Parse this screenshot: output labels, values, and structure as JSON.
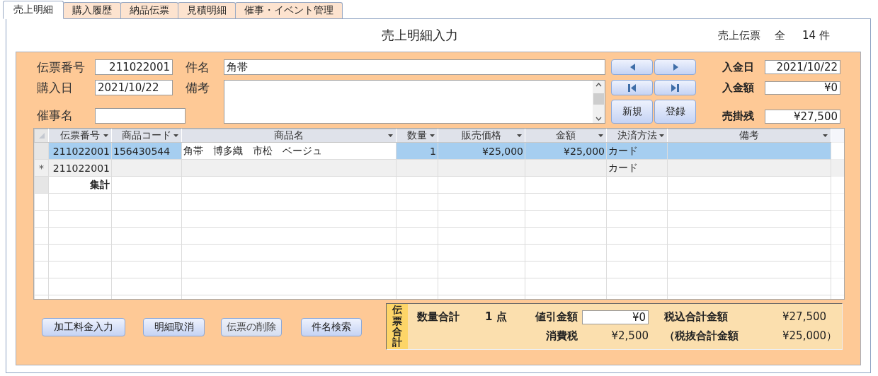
{
  "tabs": [
    {
      "label": "売上明細",
      "selected": true
    },
    {
      "label": "購入履歴",
      "selected": false
    },
    {
      "label": "納品伝票",
      "selected": false
    },
    {
      "label": "見積明細",
      "selected": false
    },
    {
      "label": "催事・イベント管理",
      "selected": false
    }
  ],
  "title": "売上明細入力",
  "record_count": {
    "label": "売上伝票",
    "scope": "全",
    "count": "14 件"
  },
  "form": {
    "slip_no": {
      "label": "伝票番号",
      "value": "211022001"
    },
    "purchase_date": {
      "label": "購入日",
      "value": "2021/10/22"
    },
    "event_name": {
      "label": "催事名"
    },
    "subject": {
      "label": "件名",
      "value": "角帯"
    },
    "remarks": {
      "label": "備考"
    },
    "new_button": "新規",
    "register_button": "登録",
    "payment_date": {
      "label": "入金日",
      "value": "2021/10/22"
    },
    "payment_amount": {
      "label": "入金額",
      "value": "¥0"
    },
    "receivable": {
      "label": "売掛残",
      "value": "¥27,500"
    }
  },
  "table": {
    "columns": [
      {
        "label": "伝票番号",
        "kind": "number"
      },
      {
        "label": "商品コード",
        "kind": "text"
      },
      {
        "label": "商品名",
        "kind": "text"
      },
      {
        "label": "数量",
        "kind": "number"
      },
      {
        "label": "販売価格",
        "kind": "number"
      },
      {
        "label": "金額",
        "kind": "number"
      },
      {
        "label": "決済方法",
        "kind": "text"
      },
      {
        "label": "備考",
        "kind": "text"
      }
    ],
    "rows": [
      {
        "kind": "record",
        "selected": true,
        "cells": [
          {
            "text": "211022001"
          },
          {
            "text": "156430544"
          },
          {
            "text": "角帯　博多織　市松　ベージュ",
            "focused": true
          },
          {
            "text": "1"
          },
          {
            "text": "¥25,000"
          },
          {
            "text": "¥25,000"
          },
          {
            "text": "カード"
          },
          {}
        ]
      },
      {
        "kind": "new",
        "selected": false,
        "marker": "*",
        "cells": [
          {
            "text": "211022001"
          },
          {},
          {},
          {},
          {},
          {},
          {
            "text": "カード"
          },
          {}
        ]
      },
      {
        "kind": "total",
        "selected": false,
        "cells": [
          {
            "text": "集計"
          },
          {},
          {},
          {},
          {},
          {},
          {},
          {}
        ]
      }
    ]
  },
  "buttons": [
    {
      "label": "加工料金入力",
      "disabled": false
    },
    {
      "label": "明細取消",
      "disabled": false
    },
    {
      "label": "伝票の削除",
      "disabled": true
    },
    {
      "label": "件名検索",
      "disabled": false
    }
  ],
  "summary": {
    "side_label": "伝票合計",
    "quantity_total": {
      "label": "数量合計",
      "value": "1 点"
    },
    "discount": {
      "label": "値引金額",
      "value": "¥0"
    },
    "tax_included_total": {
      "label": "税込合計金額",
      "value": "¥27,500"
    },
    "tax": {
      "label": "消費税",
      "value": "¥2,500"
    },
    "tax_excluded_total": {
      "label": "（税抜合計金額",
      "value": "¥25,000）"
    }
  }
}
